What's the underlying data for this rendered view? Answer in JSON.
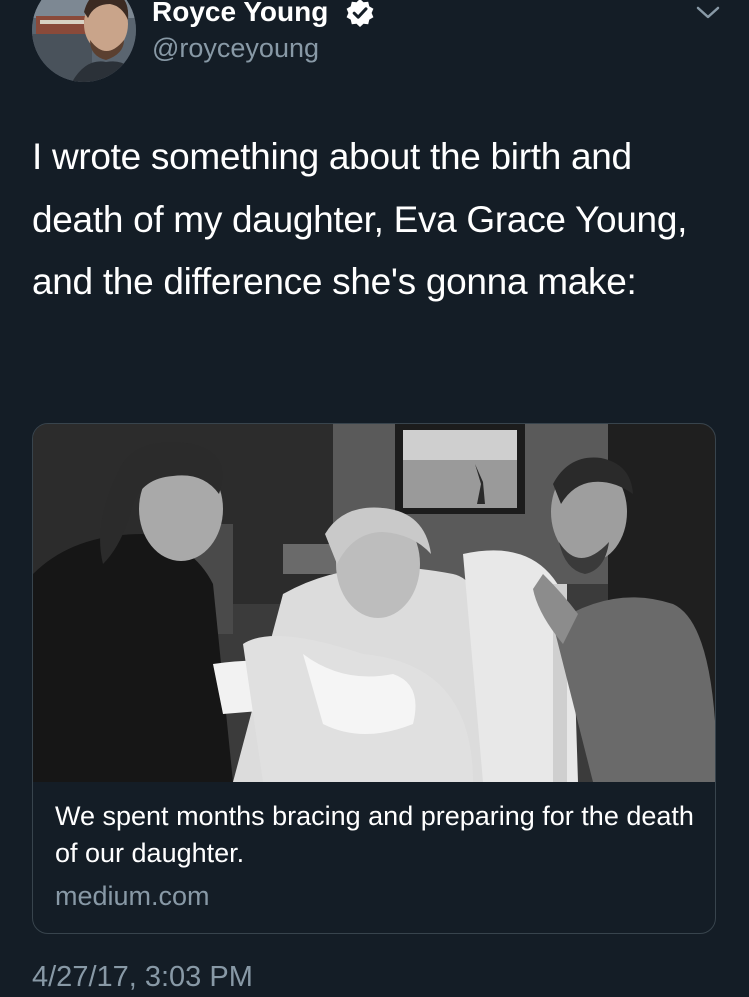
{
  "tweet": {
    "author": {
      "display_name": "Royce Young",
      "handle": "@royceyoung",
      "verified": true,
      "avatar_icon": "avatar-photo"
    },
    "menu_icon": "chevron-down-icon",
    "text": "I wrote something about the birth and death of my daughter, Eva Grace Young, and the difference she's gonna make:",
    "card": {
      "image_icon": "hospital-photo",
      "title": "We spent months bracing and preparing for the death of our daughter.",
      "domain": "medium.com"
    },
    "timestamp": "4/27/17, 3:03 PM"
  },
  "colors": {
    "background": "#141d26",
    "primary_text": "#ffffff",
    "secondary_text": "#8899a6",
    "card_border": "#38444d",
    "verified_badge": "#ffffff"
  }
}
